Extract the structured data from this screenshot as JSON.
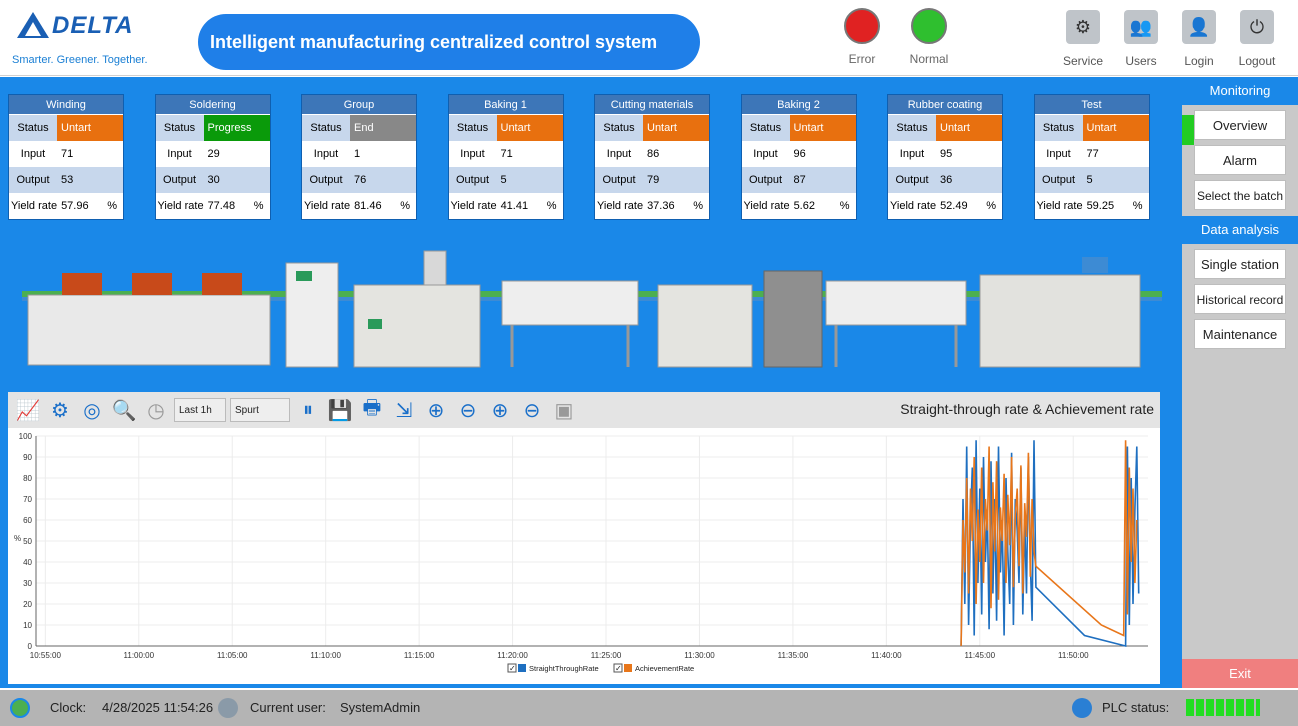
{
  "header": {
    "brand": "DELTA",
    "tagline": "Smarter. Greener. Together.",
    "title": "Intelligent manufacturing centralized control system",
    "lamps": [
      {
        "label": "Error",
        "color": "#e02222"
      },
      {
        "label": "Normal",
        "color": "#2fbf2f"
      }
    ],
    "buttons": [
      {
        "label": "Service",
        "icon": "cog-icon"
      },
      {
        "label": "Users",
        "icon": "users-icon"
      },
      {
        "label": "Login",
        "icon": "user-icon"
      },
      {
        "label": "Logout",
        "icon": "power-icon"
      }
    ]
  },
  "stations": [
    {
      "name": "Winding",
      "status": "Untart",
      "status_color": "#e8700f",
      "input": "71",
      "output": "53",
      "yield": "57.96"
    },
    {
      "name": "Soldering",
      "status": "Progress",
      "status_color": "#0a9a0a",
      "input": "29",
      "output": "30",
      "yield": "77.48"
    },
    {
      "name": "Group",
      "status": "End",
      "status_color": "#888888",
      "input": "1",
      "output": "76",
      "yield": "81.46"
    },
    {
      "name": "Baking 1",
      "status": "Untart",
      "status_color": "#e8700f",
      "input": "71",
      "output": "5",
      "yield": "41.41"
    },
    {
      "name": "Cutting materials",
      "status": "Untart",
      "status_color": "#e8700f",
      "input": "86",
      "output": "79",
      "yield": "37.36"
    },
    {
      "name": "Baking 2",
      "status": "Untart",
      "status_color": "#e8700f",
      "input": "96",
      "output": "87",
      "yield": "5.62"
    },
    {
      "name": "Rubber coating",
      "status": "Untart",
      "status_color": "#e8700f",
      "input": "95",
      "output": "36",
      "yield": "52.49"
    },
    {
      "name": "Test",
      "status": "Untart",
      "status_color": "#e8700f",
      "input": "77",
      "output": "5",
      "yield": "59.25"
    }
  ],
  "labels": {
    "status": "Status",
    "input": "Input",
    "output": "Output",
    "yield": "Yield rate",
    "unit": "%"
  },
  "toolbar": {
    "range": "Last 1h",
    "mode": "Spurt"
  },
  "sidebar": {
    "monitoring": "Monitoring",
    "overview": "Overview",
    "alarm": "Alarm",
    "batch": "Select the batch",
    "data_analysis": "Data analysis",
    "single": "Single station",
    "historical": "Historical record",
    "maintenance": "Maintenance",
    "exit": "Exit"
  },
  "status_bar": {
    "clock_label": "Clock:",
    "clock_value": "4/28/2025 11:54:26",
    "user_label": "Current user:",
    "user_value": "SystemAdmin",
    "plc_label": "PLC status:"
  },
  "chart_data": {
    "type": "line",
    "title": "Straight-through rate & Achievement rate",
    "ylabel": "%",
    "ylim": [
      0,
      100
    ],
    "yticks": [
      0,
      10,
      20,
      30,
      40,
      50,
      60,
      70,
      80,
      90,
      100
    ],
    "xticks": [
      "10:55:00",
      "11:00:00",
      "11:05:00",
      "11:10:00",
      "11:15:00",
      "11:20:00",
      "11:25:00",
      "11:30:00",
      "11:35:00",
      "11:40:00",
      "11:45:00",
      "11:50:00"
    ],
    "xrange_minutes": [
      -0.5,
      59
    ],
    "legend": "bottom-center",
    "series": [
      {
        "name": "StraightThroughRate",
        "color": "#1e6fc0",
        "x": [
          49.0,
          49.1,
          49.2,
          49.3,
          49.4,
          49.5,
          49.6,
          49.7,
          49.8,
          49.9,
          50.0,
          50.1,
          50.2,
          50.3,
          50.4,
          50.5,
          50.6,
          50.7,
          50.8,
          50.9,
          51.0,
          51.1,
          51.2,
          51.3,
          51.4,
          51.5,
          51.6,
          51.7,
          51.8,
          51.9,
          52.0,
          52.1,
          52.2,
          52.3,
          52.4,
          52.5,
          52.6,
          52.7,
          52.8,
          52.9,
          53.0,
          55.6,
          57.8,
          57.9,
          58.0,
          58.1,
          58.2,
          58.3,
          58.4,
          58.5
        ],
        "y": [
          0,
          70,
          20,
          95,
          10,
          60,
          85,
          5,
          98,
          30,
          75,
          15,
          90,
          40,
          65,
          8,
          88,
          25,
          70,
          12,
          95,
          35,
          60,
          5,
          80,
          45,
          20,
          92,
          10,
          70,
          55,
          30,
          85,
          15,
          60,
          25,
          90,
          40,
          12,
          98,
          28,
          5,
          0,
          95,
          10,
          80,
          20,
          65,
          95,
          25
        ]
      },
      {
        "name": "AchievementRate",
        "color": "#e8761a",
        "x": [
          49.0,
          49.1,
          49.2,
          49.3,
          49.4,
          49.5,
          49.6,
          49.7,
          49.8,
          49.9,
          50.0,
          50.1,
          50.2,
          50.3,
          50.4,
          50.5,
          50.6,
          50.7,
          50.8,
          50.9,
          51.0,
          51.1,
          51.2,
          51.3,
          51.4,
          51.5,
          51.6,
          51.7,
          51.8,
          51.9,
          52.0,
          52.1,
          52.2,
          52.3,
          52.4,
          52.5,
          52.6,
          52.7,
          52.8,
          52.9,
          53.0,
          56.5,
          57.7,
          57.8,
          57.9,
          58.0,
          58.1,
          58.2,
          58.3,
          58.4
        ],
        "y": [
          0,
          60,
          35,
          80,
          25,
          75,
          50,
          90,
          20,
          65,
          40,
          85,
          30,
          70,
          55,
          95,
          18,
          78,
          45,
          88,
          22,
          66,
          50,
          82,
          30,
          72,
          48,
          90,
          28,
          62,
          75,
          38,
          86,
          25,
          68,
          52,
          92,
          33,
          70,
          45,
          38,
          10,
          5,
          98,
          15,
          85,
          40,
          75,
          30,
          60
        ]
      }
    ]
  }
}
